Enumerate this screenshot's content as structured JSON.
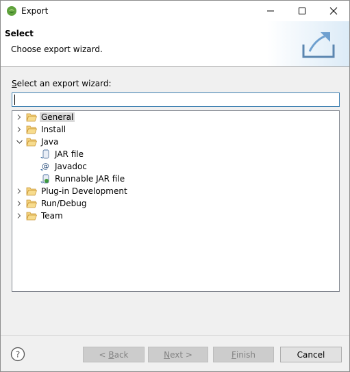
{
  "window": {
    "title": "Export"
  },
  "header": {
    "title": "Select",
    "description": "Choose export wizard."
  },
  "filter": {
    "label_mnemonic": "S",
    "label_rest": "elect an export wizard:",
    "value": ""
  },
  "tree": {
    "items": [
      {
        "label": "General",
        "icon": "folder-open-icon",
        "expanded": false,
        "selected": true
      },
      {
        "label": "Install",
        "icon": "folder-open-icon",
        "expanded": false
      },
      {
        "label": "Java",
        "icon": "folder-open-icon",
        "expanded": true
      },
      {
        "label": "JAR file",
        "icon": "jar-file-icon",
        "child": true
      },
      {
        "label": "Javadoc",
        "icon": "javadoc-icon",
        "child": true
      },
      {
        "label": "Runnable JAR file",
        "icon": "runnable-jar-icon",
        "child": true
      },
      {
        "label": "Plug-in Development",
        "icon": "folder-open-icon",
        "expanded": false
      },
      {
        "label": "Run/Debug",
        "icon": "folder-open-icon",
        "expanded": false
      },
      {
        "label": "Team",
        "icon": "folder-open-icon",
        "expanded": false
      }
    ]
  },
  "buttons": {
    "back_mnemonic": "B",
    "back_prefix": "< ",
    "back_rest": "ack",
    "next_mnemonic": "N",
    "next_rest": "ext >",
    "finish_mnemonic": "F",
    "finish_rest": "inish",
    "cancel": "Cancel"
  },
  "colors": {
    "accent": "#3c7fb1",
    "selection": "#d9d9d9",
    "folder": "#e8b54a"
  }
}
